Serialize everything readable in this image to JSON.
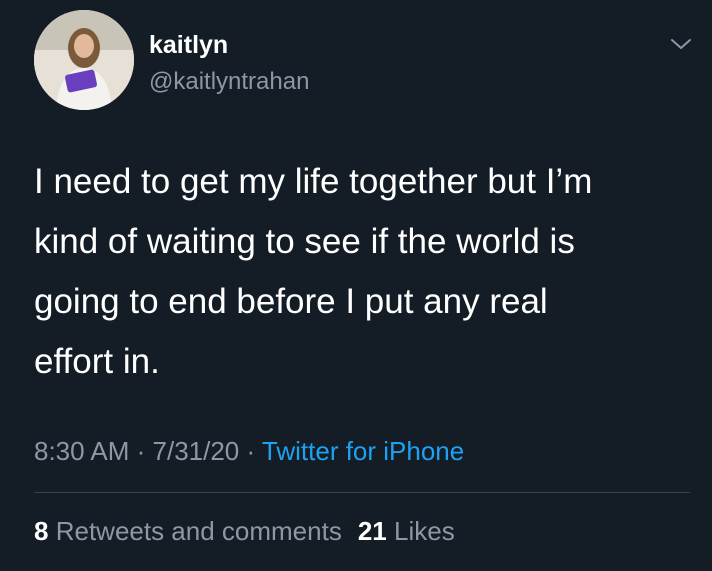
{
  "user": {
    "display_name": "kaitlyn",
    "handle": "@kaitlyntrahan"
  },
  "tweet": {
    "lines": [
      "I need to get my life together but I’m",
      "kind of waiting to see if the world is",
      "going to end before I put any real",
      "effort in."
    ],
    "time": "8:30 AM",
    "date": "7/31/20",
    "separator": " · ",
    "source": "Twitter for iPhone"
  },
  "stats": {
    "retweets_count": "8",
    "retweets_label": "Retweets and comments",
    "likes_count": "21",
    "likes_label": "Likes"
  },
  "icons": {
    "menu": "chevron-down-icon"
  },
  "colors": {
    "background": "#141d26",
    "secondary_text": "#8b98a5",
    "link": "#1da1f2"
  }
}
